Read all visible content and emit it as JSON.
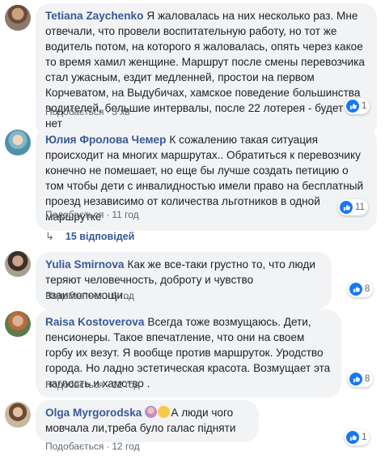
{
  "comments": [
    {
      "author": "Tetiana Zaychenko",
      "text": "Я жаловалась на них несколько раз. Мне отвечали, что провели воспитательную работу, но тот же водитель потом, на которого я жаловалась, опять через какое то время хамил женщине. Маршрут после смены перевозчика стал ужасным, ездит медленней, простои на первом Корчеватом, на Выдубичах, хамское поведение большинства водителей, большие интервалы, после 22 лотерея - будет или нет",
      "like_label": "Подобається",
      "time": "3 хв",
      "reactions": "1"
    },
    {
      "author": "Юлия Фролова Чемер",
      "text": "К сожалению такая ситуация происходит на многих маршрутах.. Обратиться к перевозчику конечно не помешает, но еще бы лучше создать петицию о том чтобы дети с инвалидностью имели право на бесплатный проезд независимо от количества льготников в одной маршрутке",
      "like_label": "Подобається",
      "time": "11 год",
      "reactions": "11"
    },
    {
      "author": "Yulia Smirnova",
      "text": "Как же все-таки грустно то, что люди теряют человечность, доброту и чувство взаимопомощи...",
      "like_label": "Подобається",
      "time": "6 год",
      "reactions": "8"
    },
    {
      "author": "Raisa Kostoverova",
      "text": "Всегда тоже возмущаюсь. Дети, пенсионеры. Такое впечатление, что они на своем горбу их везут. Я вообще против маршруток. Уродство города. Но ладно эстетическая красота. Возмущает эта наглость и хамство .",
      "like_label": "Подобається",
      "time": "12 год",
      "reactions": "8"
    },
    {
      "author": "Olga Myrgorodska",
      "text": "А люди чого мовчала ли,треба було галас підняти",
      "like_label": "Подобається",
      "time": "12 год",
      "reactions": "1"
    }
  ],
  "replies_label": "15 відповідей",
  "separator": "·",
  "colors": {
    "author": "#385898",
    "bubble": "#f2f3f5",
    "like_blue": "#1877f2",
    "meta": "#606770"
  },
  "icons": [
    "thumbs-up-icon",
    "reply-arrow-icon",
    "woman-gesturing-emoji",
    "sad-face-emoji"
  ]
}
